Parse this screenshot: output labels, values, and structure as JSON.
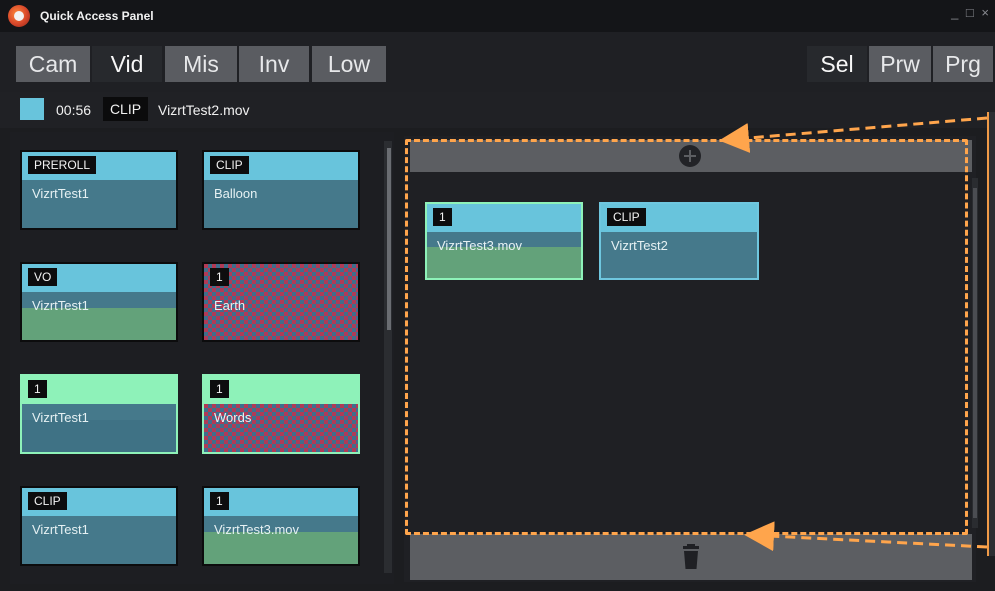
{
  "window": {
    "title": "Quick Access Panel",
    "controls": "_ □ ×"
  },
  "tabs_left": [
    "Cam",
    "Vid",
    "Mis",
    "Inv",
    "Low"
  ],
  "active_tab_left": "Vid",
  "tabs_right": [
    "Sel",
    "Prw",
    "Prg"
  ],
  "active_tab_right": "Sel",
  "current_clip": {
    "time": "00:56",
    "badge": "CLIP",
    "filename": "VizrtTest2.mov"
  },
  "left_cards": [
    {
      "badge": "PREROLL",
      "label": "VizrtTest1"
    },
    {
      "badge": "CLIP",
      "label": "Balloon"
    },
    {
      "badge": "VO",
      "label": "VizrtTest1"
    },
    {
      "badge": "1",
      "label": "Earth"
    },
    {
      "badge": "1",
      "label": "VizrtTest1"
    },
    {
      "badge": "1",
      "label": "Words"
    },
    {
      "badge": "CLIP",
      "label": "VizrtTest1"
    },
    {
      "badge": "1",
      "label": "VizrtTest3.mov"
    }
  ],
  "right_cards": [
    {
      "badge": "1",
      "label": "VizrtTest3.mov"
    },
    {
      "badge": "CLIP",
      "label": "VizrtTest2"
    }
  ],
  "icons": {
    "add": "plus-circle-icon",
    "delete": "trash-icon"
  },
  "colors": {
    "cyan": "#68c4dc",
    "teal": "#43788a",
    "green": "#8ef2b9",
    "green_body": "#63a27a",
    "highlight_orange": "#ffa54c",
    "tab_active": "#27292d",
    "tab_inactive": "#5a5c61"
  }
}
